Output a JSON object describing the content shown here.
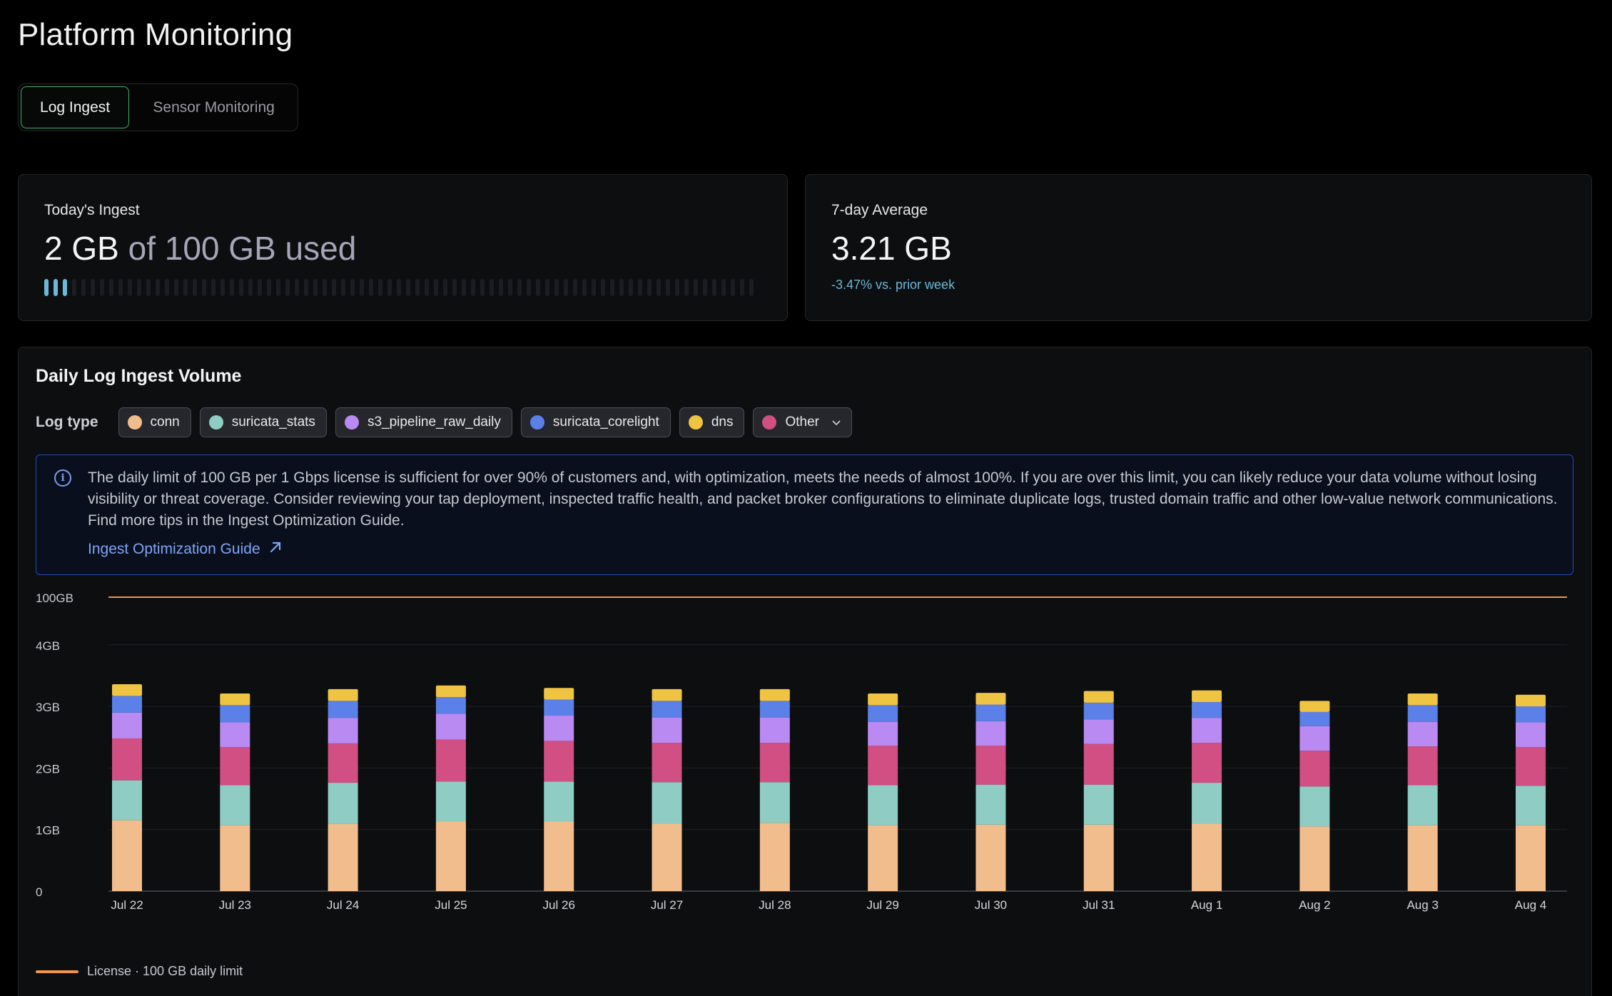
{
  "page": {
    "title": "Platform Monitoring"
  },
  "tabs": [
    {
      "label": "Log Ingest",
      "active": true
    },
    {
      "label": "Sensor Monitoring",
      "active": false
    }
  ],
  "today_ingest": {
    "label": "Today's Ingest",
    "value": "2 GB",
    "suffix": "of 100 GB used",
    "used_fraction": 0.02,
    "bar_color": "#6bb8d8"
  },
  "seven_day": {
    "label": "7-day Average",
    "value": "3.21 GB",
    "change": "-3.47% vs. prior week",
    "change_color": "#6bb8d8"
  },
  "panel": {
    "title": "Daily Log Ingest Volume",
    "filter_label": "Log type",
    "chips": [
      {
        "label": "conn",
        "color": "#f2bd8c"
      },
      {
        "label": "suricata_stats",
        "color": "#8fcdc4"
      },
      {
        "label": "s3_pipeline_raw_daily",
        "color": "#b98af2"
      },
      {
        "label": "suricata_corelight",
        "color": "#5b80e8"
      },
      {
        "label": "dns",
        "color": "#f0c443"
      },
      {
        "label": "Other",
        "color": "#d14f82",
        "dropdown": true,
        "icon": "chevron-down-icon"
      }
    ],
    "info": {
      "icon": "info-icon",
      "text": "The daily limit of 100 GB per 1 Gbps license is sufficient for over 90% of customers and, with optimization, meets the needs of almost 100%. If you are over this limit, you can likely reduce your data volume without losing visibility or threat coverage. Consider reviewing your tap deployment, inspected traffic health, and packet broker configurations to eliminate duplicate logs, trusted domain traffic and other low-value network communications. Find more tips in the Ingest Optimization Guide.",
      "link": "Ingest Optimization Guide",
      "link_icon": "external-link-icon"
    },
    "legend": "License · 100 GB daily limit"
  },
  "chart_data": {
    "type": "bar",
    "stacked": true,
    "categories": [
      "Jul 22",
      "Jul 23",
      "Jul 24",
      "Jul 25",
      "Jul 26",
      "Jul 27",
      "Jul 28",
      "Jul 29",
      "Jul 30",
      "Jul 31",
      "Aug 1",
      "Aug 2",
      "Aug 3",
      "Aug 4"
    ],
    "y_ticks": [
      "0",
      "1GB",
      "2GB",
      "3GB",
      "4GB",
      "100GB"
    ],
    "ylim": [
      0,
      4.6
    ],
    "axis_break": "scale jumps from 4GB to 100GB",
    "grid": true,
    "series": [
      {
        "name": "conn",
        "color": "#f2bd8c",
        "values": [
          1.15,
          1.07,
          1.09,
          1.13,
          1.13,
          1.1,
          1.11,
          1.07,
          1.08,
          1.08,
          1.1,
          1.05,
          1.07,
          1.07
        ]
      },
      {
        "name": "suricata_stats",
        "color": "#8fcdc4",
        "values": [
          0.65,
          0.65,
          0.67,
          0.65,
          0.65,
          0.67,
          0.66,
          0.65,
          0.65,
          0.65,
          0.66,
          0.65,
          0.65,
          0.64
        ]
      },
      {
        "name": "s3_pipeline_raw_daily",
        "color": "#d14f82",
        "values": [
          0.68,
          0.62,
          0.64,
          0.68,
          0.66,
          0.64,
          0.64,
          0.64,
          0.63,
          0.66,
          0.65,
          0.58,
          0.63,
          0.63
        ]
      },
      {
        "name": "suricata_corelight",
        "color": "#b98af2",
        "values": [
          0.42,
          0.4,
          0.41,
          0.42,
          0.41,
          0.41,
          0.41,
          0.39,
          0.4,
          0.4,
          0.4,
          0.4,
          0.4,
          0.4
        ]
      },
      {
        "name": "dns",
        "color": "#5b80e8",
        "values": [
          0.27,
          0.28,
          0.28,
          0.27,
          0.26,
          0.27,
          0.27,
          0.27,
          0.27,
          0.27,
          0.26,
          0.23,
          0.27,
          0.26
        ]
      },
      {
        "name": "Other",
        "color": "#f0c443",
        "values": [
          0.19,
          0.19,
          0.19,
          0.19,
          0.19,
          0.19,
          0.19,
          0.19,
          0.19,
          0.19,
          0.19,
          0.18,
          0.19,
          0.19
        ]
      }
    ],
    "limit_line": {
      "label": "License · 100 GB daily limit",
      "value_gb": 100,
      "color": "#f0954a"
    }
  }
}
